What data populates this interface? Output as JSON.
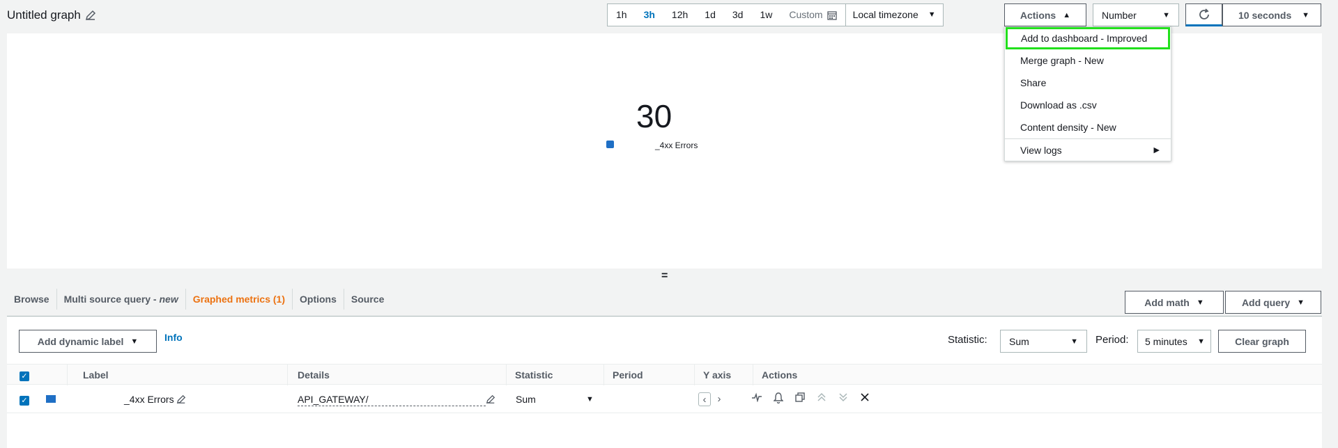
{
  "header": {
    "title": "Untitled graph",
    "time_ranges": [
      "1h",
      "3h",
      "12h",
      "1d",
      "3d",
      "1w"
    ],
    "active_range": "3h",
    "custom_label": "Custom",
    "timezone": "Local timezone",
    "actions_label": "Actions",
    "view_type": "Number",
    "refresh_interval": "10 seconds"
  },
  "actions_menu": {
    "items": [
      "Add to dashboard - Improved",
      "Merge graph - New",
      "Share",
      "Download as .csv",
      "Content density - New"
    ],
    "view_logs": "View logs"
  },
  "graph": {
    "value": "30",
    "legend_label": "_4xx Errors"
  },
  "tabs": {
    "browse": "Browse",
    "multi_source": "Multi source query - ",
    "multi_source_new": "new",
    "graphed": "Graphed metrics (1)",
    "options": "Options",
    "source": "Source"
  },
  "toolbar": {
    "add_math": "Add math",
    "add_query": "Add query",
    "add_dynamic_label": "Add dynamic label",
    "info": "Info",
    "statistic_label": "Statistic:",
    "statistic_value": "Sum",
    "period_label": "Period:",
    "period_value": "5 minutes",
    "clear_graph": "Clear graph"
  },
  "table": {
    "headers": [
      "Label",
      "Details",
      "Statistic",
      "Period",
      "Y axis",
      "Actions"
    ],
    "row": {
      "label": "_4xx Errors",
      "details": "API_GATEWAY/",
      "statistic": "Sum"
    }
  },
  "colors": {
    "accent": "#0073bb",
    "active_tab": "#ec7211",
    "highlight": "#22e01c",
    "series": "#1f6fc5"
  }
}
